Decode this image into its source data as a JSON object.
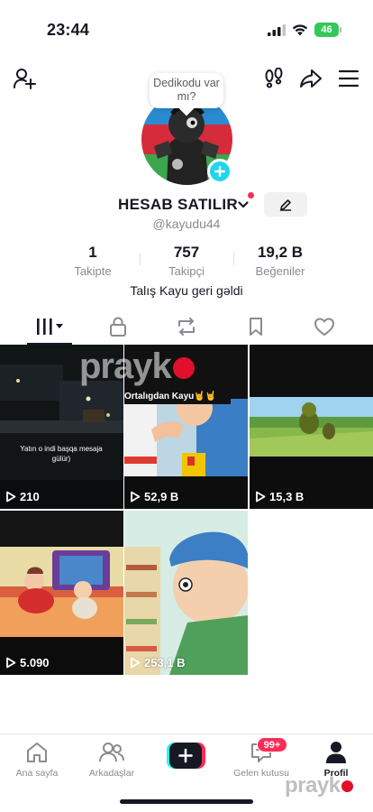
{
  "status_bar": {
    "time": "23:44",
    "battery": "46"
  },
  "header": {
    "bubble_text": "Dedikodu var mı?"
  },
  "profile": {
    "name": "HESAB SATILIR",
    "handle": "@kayudu44",
    "bio": "Talış Kayu geri gəldi",
    "stats": [
      {
        "value": "1",
        "label": "Takipte"
      },
      {
        "value": "757",
        "label": "Takipçi"
      },
      {
        "value": "19,2 B",
        "label": "Beğeniler"
      }
    ]
  },
  "tabs": [
    {
      "icon": "videos-grid-icon"
    },
    {
      "icon": "lock-icon"
    },
    {
      "icon": "repost-icon"
    },
    {
      "icon": "bookmark-icon"
    },
    {
      "icon": "heart-icon"
    }
  ],
  "videos": [
    {
      "views": "210",
      "caption": "Yatın o indi başqa mesaja gülür)"
    },
    {
      "views": "52,9 B",
      "caption": "Ortalıgdan Kayu🤘🤘"
    },
    {
      "views": "15,3 B"
    },
    {
      "views": "5.090"
    },
    {
      "views": "253,1 B"
    }
  ],
  "bottom_nav": [
    {
      "label": "Ana sayfa",
      "icon": "home-icon"
    },
    {
      "label": "Arkadaşlar",
      "icon": "friends-icon"
    },
    {
      "label": "",
      "icon": "create-icon"
    },
    {
      "label": "Gelen kutusu",
      "icon": "inbox-icon",
      "badge": "99+"
    },
    {
      "label": "Profil",
      "icon": "profile-icon"
    }
  ],
  "watermark": {
    "text": "prayk"
  },
  "colors": {
    "accent_red": "#fe2c55",
    "accent_cyan": "#20d5ec",
    "battery_green": "#34c759"
  }
}
